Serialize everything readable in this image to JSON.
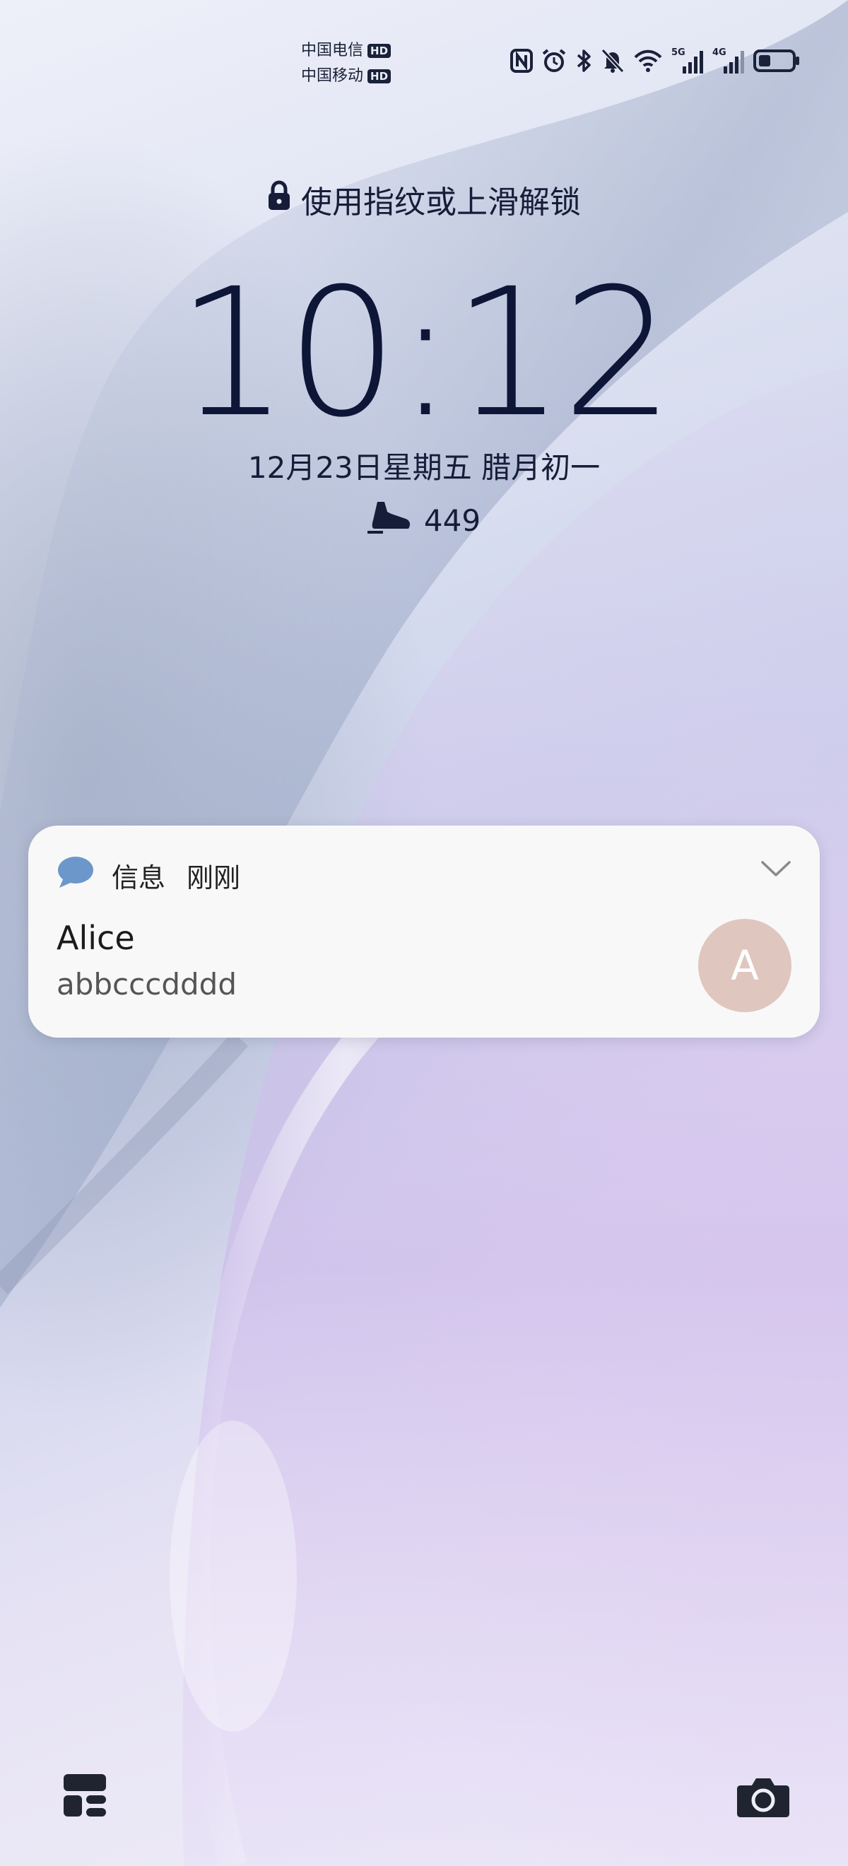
{
  "status_bar": {
    "carrier1": "中国电信",
    "carrier2": "中国移动",
    "hd": "HD",
    "net1": "5G",
    "net2": "4G",
    "icons": [
      "nfc-icon",
      "alarm-icon",
      "bluetooth-icon",
      "mute-icon",
      "wifi-icon",
      "signal-5g-icon",
      "signal-4g-icon",
      "battery-icon"
    ]
  },
  "lock": {
    "hint": "使用指纹或上滑解锁"
  },
  "clock": {
    "time": "10:12",
    "date": "12月23日星期五  腊月初一",
    "steps": "449"
  },
  "notification": {
    "app": "信息",
    "time": "刚刚",
    "title": "Alice",
    "body": "abbcccdddd",
    "avatar_letter": "A",
    "avatar_color": "#dfc6bf"
  },
  "colors": {
    "text_dark": "#0e1638",
    "message_icon": "#6c97cb",
    "card_bg": "#f8f8f8"
  }
}
